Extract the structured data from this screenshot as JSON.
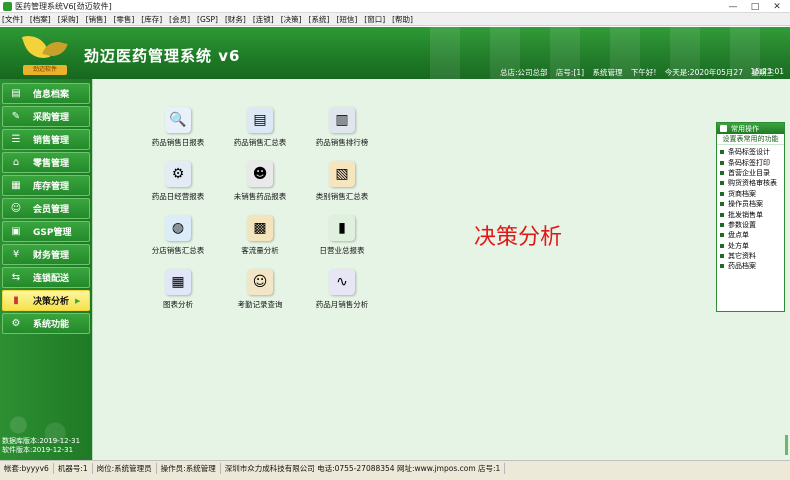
{
  "window": {
    "title": "医药管理系统V6[劲迈软件]",
    "controls": [
      "—",
      "□",
      "✕"
    ]
  },
  "menu": [
    "[文件]",
    "[档案]",
    "[采购]",
    "[销售]",
    "[零售]",
    "[库存]",
    "[会员]",
    "[GSP]",
    "[财务]",
    "[连锁]",
    "[决策]",
    "[系统]",
    "[短信]",
    "[窗口]",
    "[帮助]"
  ],
  "banner": {
    "logo_text": "劲迈软件",
    "app_title": "劲迈医药管理系统 v6",
    "status": [
      "总店:公司总部",
      "店号:[1]",
      "系统管理",
      "下午好!",
      "今天是:2020年05月27",
      "星期三"
    ],
    "clock": "15:23:01"
  },
  "sidebar": {
    "items": [
      {
        "label": "信息档案",
        "icon": "folder-icon"
      },
      {
        "label": "采购管理",
        "icon": "pen-icon"
      },
      {
        "label": "销售管理",
        "icon": "list-icon"
      },
      {
        "label": "零售管理",
        "icon": "cart-icon"
      },
      {
        "label": "库存管理",
        "icon": "box-icon"
      },
      {
        "label": "会员管理",
        "icon": "people-icon"
      },
      {
        "label": "GSP管理",
        "icon": "book-icon"
      },
      {
        "label": "财务管理",
        "icon": "money-icon"
      },
      {
        "label": "连锁配送",
        "icon": "truck-icon"
      },
      {
        "label": "决策分析",
        "icon": "chart-icon",
        "active": true,
        "chevron": "▶"
      },
      {
        "label": "系统功能",
        "icon": "gear-icon"
      }
    ],
    "expiry_line1": "数据库版本:2019-12-31",
    "expiry_line2": "软件版本:2019-12-31"
  },
  "main": {
    "section_label": "决策分析",
    "tiles": [
      {
        "label": "药品销售日报表",
        "icon": "magnifier-icon",
        "color": "#5c9bd8"
      },
      {
        "label": "药品销售汇总表",
        "icon": "report-icon",
        "color": "#4b7fc4"
      },
      {
        "label": "药品销售排行榜",
        "icon": "building-icon",
        "color": "#6f8fb4"
      },
      {
        "label": "药品日经营报表",
        "icon": "gear-doc-icon",
        "color": "#7fa7c7"
      },
      {
        "label": "未销售药品报表",
        "icon": "person-doc-icon",
        "color": "#8a8a8a"
      },
      {
        "label": "类别销售汇总表",
        "icon": "box-icon",
        "color": "#e6b64a"
      },
      {
        "label": "分店销售汇总表",
        "icon": "globe-icon",
        "color": "#4aa0d8"
      },
      {
        "label": "客流量分析",
        "icon": "boxes-icon",
        "color": "#e0b050"
      },
      {
        "label": "日营业总报表",
        "icon": "bar-chart-icon",
        "color": "#3aa04a"
      },
      {
        "label": "图表分析",
        "icon": "chart-doc-icon",
        "color": "#5c8ad8"
      },
      {
        "label": "考勤记录查询",
        "icon": "clock-people-icon",
        "color": "#d0a040"
      },
      {
        "label": "药品月销售分析",
        "icon": "line-chart-icon",
        "color": "#7a7ad0"
      }
    ]
  },
  "quick_panel": {
    "header": "常用操作",
    "subheader": "设置表常用的功能",
    "items": [
      "条码标签设计",
      "条码标签打印",
      "首营企业目录",
      "购货资格审核表",
      "货商档案",
      "操作员档案",
      "批发销售单",
      "参数设置",
      "盘点单",
      "处方单",
      "其它资料",
      "药品档案"
    ]
  },
  "statusbar": {
    "items": [
      "帐套:byyyv6",
      "机器号:1",
      "岗位:系统管理员",
      "操作员:系统管理",
      "深圳市众力成科技有限公司 电话:0755-27088354 网址:www.jmpos.com 店号:1"
    ]
  }
}
